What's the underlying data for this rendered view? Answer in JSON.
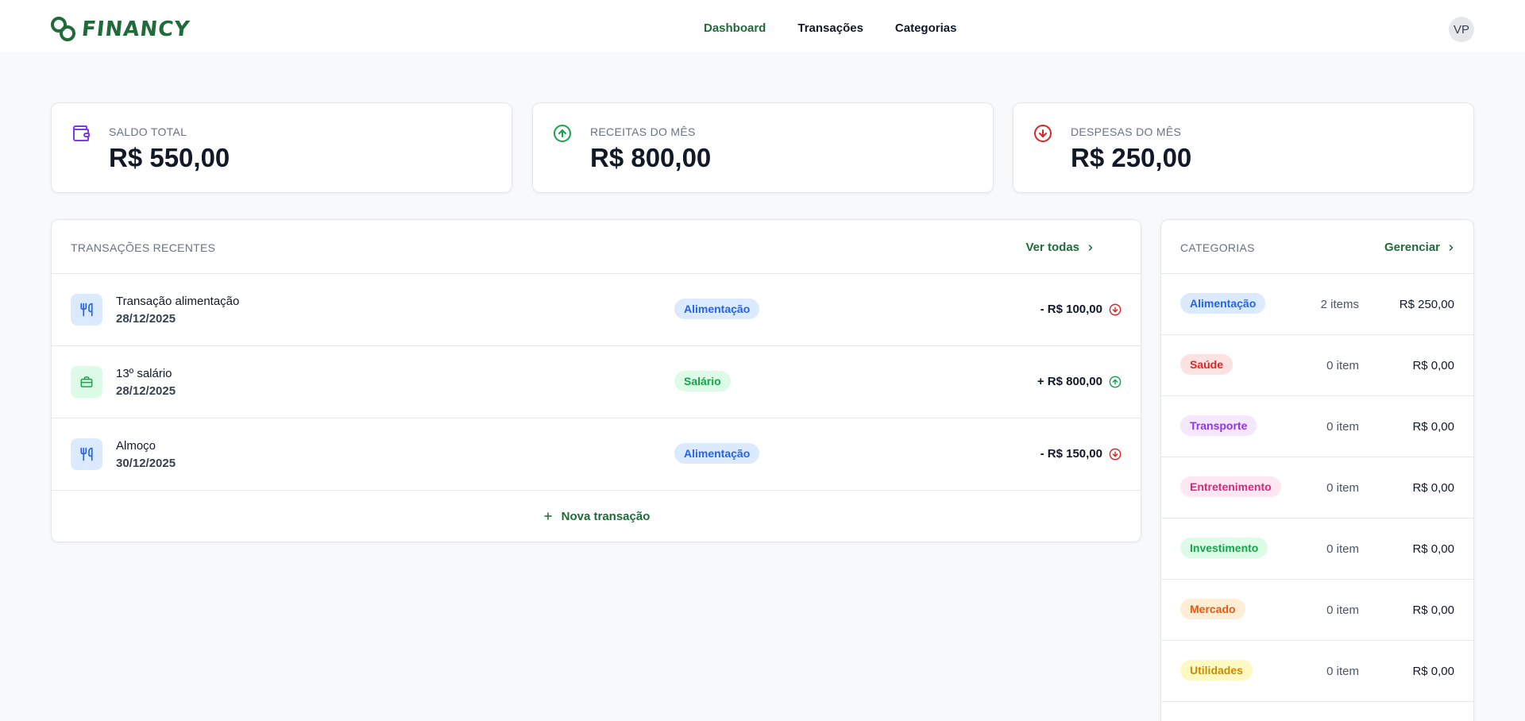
{
  "brand": {
    "name": "FINANCY",
    "color": "#1f6b3a"
  },
  "nav": {
    "items": [
      {
        "label": "Dashboard",
        "active": true
      },
      {
        "label": "Transações",
        "active": false
      },
      {
        "label": "Categorias",
        "active": false
      }
    ]
  },
  "user": {
    "initials": "VP"
  },
  "summary": [
    {
      "label": "SALDO TOTAL",
      "value": "R$ 550,00",
      "icon": "wallet-icon",
      "color": "#7c3aed"
    },
    {
      "label": "RECEITAS DO MÊS",
      "value": "R$ 800,00",
      "icon": "arrow-up-circle-icon",
      "color": "#16a34a"
    },
    {
      "label": "DESPESAS DO MÊS",
      "value": "R$ 250,00",
      "icon": "arrow-down-circle-icon",
      "color": "#dc2626"
    }
  ],
  "transactions": {
    "title": "TRANSAÇÕES RECENTES",
    "view_all": "Ver todas",
    "new_label": "Nova transação",
    "rows": [
      {
        "name": "Transação alimentação",
        "date": "28/12/2025",
        "category": "Alimentação",
        "amount": "- R$ 100,00",
        "type": "expense",
        "icon": "utensils-icon"
      },
      {
        "name": "13º salário",
        "date": "28/12/2025",
        "category": "Salário",
        "amount": "+ R$ 800,00",
        "type": "income",
        "icon": "briefcase-icon"
      },
      {
        "name": "Almoço",
        "date": "30/12/2025",
        "category": "Alimentação",
        "amount": "- R$ 150,00",
        "type": "expense",
        "icon": "utensils-icon"
      }
    ]
  },
  "categories": {
    "title": "CATEGORIAS",
    "manage": "Gerenciar",
    "rows": [
      {
        "name": "Alimentação",
        "count": "2 items",
        "total": "R$ 250,00",
        "bg": "#dbeafe",
        "fg": "#2563eb"
      },
      {
        "name": "Saúde",
        "count": "0 item",
        "total": "R$ 0,00",
        "bg": "#fee2e2",
        "fg": "#dc2626"
      },
      {
        "name": "Transporte",
        "count": "0 item",
        "total": "R$ 0,00",
        "bg": "#f3e8ff",
        "fg": "#9333ea"
      },
      {
        "name": "Entretenimento",
        "count": "0 item",
        "total": "R$ 0,00",
        "bg": "#fce7f3",
        "fg": "#db2777"
      },
      {
        "name": "Investimento",
        "count": "0 item",
        "total": "R$ 0,00",
        "bg": "#dcfce7",
        "fg": "#16a34a"
      },
      {
        "name": "Mercado",
        "count": "0 item",
        "total": "R$ 0,00",
        "bg": "#ffedd5",
        "fg": "#ea580c"
      },
      {
        "name": "Utilidades",
        "count": "0 item",
        "total": "R$ 0,00",
        "bg": "#fef9c3",
        "fg": "#ca8a04"
      }
    ]
  }
}
